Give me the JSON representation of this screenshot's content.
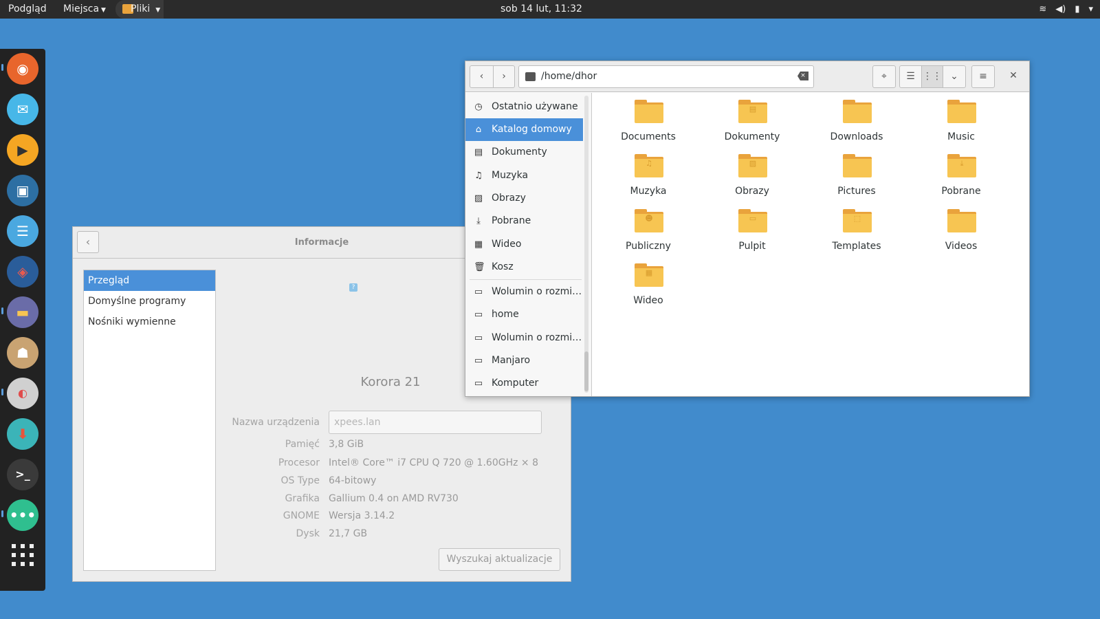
{
  "topbar": {
    "activities": "Podgląd",
    "places_menu": "Miejsca",
    "app_menu": "Pliki",
    "clock": "sob 14 lut, 11:32",
    "icons": [
      "wifi-icon",
      "volume-icon",
      "battery-icon",
      "power-menu-icon"
    ]
  },
  "dock": {
    "items": [
      {
        "name": "firefox",
        "color": "#e8652c"
      },
      {
        "name": "mail",
        "color": "#47b7e8"
      },
      {
        "name": "media-player",
        "color": "#f5a623"
      },
      {
        "name": "image-viewer",
        "color": "#2d6fa3"
      },
      {
        "name": "text-editor",
        "color": "#4aa8e0"
      },
      {
        "name": "software-center",
        "color": "#2a5d9a"
      },
      {
        "name": "files",
        "color": "#6a6ca8"
      },
      {
        "name": "store",
        "color": "#c9a372"
      },
      {
        "name": "settings-toggles",
        "color": "#d0d0d0"
      },
      {
        "name": "updater",
        "color": "#3bb4b8"
      },
      {
        "name": "terminal",
        "color": "#3a3a3a"
      },
      {
        "name": "chat",
        "color": "#2fbf8f"
      }
    ]
  },
  "settings": {
    "title": "Informacje",
    "sidebar": [
      "Przegląd",
      "Domyślne programy",
      "Nośniki wymienne"
    ],
    "os_name": "Korora 21",
    "device_name_label": "Nazwa urządzenia",
    "device_name_value": "xpees.lan",
    "rows": [
      {
        "label": "Pamięć",
        "value": "3,8 GiB"
      },
      {
        "label": "Procesor",
        "value": "Intel® Core™ i7 CPU Q 720 @ 1.60GHz × 8"
      },
      {
        "label": "OS Type",
        "value": "64-bitowy"
      },
      {
        "label": "Grafika",
        "value": "Gallium 0.4 on AMD RV730"
      },
      {
        "label": "GNOME",
        "value": "Wersja 3.14.2"
      },
      {
        "label": "Dysk",
        "value": "21,7 GB"
      }
    ],
    "update_button": "Wyszukaj aktualizacje"
  },
  "files": {
    "path": "/home/dhor",
    "places": [
      {
        "label": "Ostatnio używane",
        "icon": "recent-icon"
      },
      {
        "label": "Katalog domowy",
        "icon": "home-icon"
      },
      {
        "label": "Dokumenty",
        "icon": "document-icon"
      },
      {
        "label": "Muzyka",
        "icon": "music-icon"
      },
      {
        "label": "Obrazy",
        "icon": "pictures-icon"
      },
      {
        "label": "Pobrane",
        "icon": "download-icon"
      },
      {
        "label": "Wideo",
        "icon": "video-icon"
      },
      {
        "label": "Kosz",
        "icon": "trash-icon"
      },
      {
        "label": "Wolumin o rozmia…",
        "icon": "drive-icon"
      },
      {
        "label": "home",
        "icon": "drive-icon"
      },
      {
        "label": "Wolumin o rozmia…",
        "icon": "drive-icon"
      },
      {
        "label": "Manjaro",
        "icon": "drive-icon"
      },
      {
        "label": "Komputer",
        "icon": "computer-icon"
      }
    ],
    "items": [
      {
        "label": "Documents",
        "emblem": ""
      },
      {
        "label": "Dokumenty",
        "emblem": "document"
      },
      {
        "label": "Downloads",
        "emblem": ""
      },
      {
        "label": "Music",
        "emblem": ""
      },
      {
        "label": "Muzyka",
        "emblem": "music"
      },
      {
        "label": "Obrazy",
        "emblem": "pictures"
      },
      {
        "label": "Pictures",
        "emblem": ""
      },
      {
        "label": "Pobrane",
        "emblem": "download"
      },
      {
        "label": "Publiczny",
        "emblem": "public"
      },
      {
        "label": "Pulpit",
        "emblem": "desktop"
      },
      {
        "label": "Templates",
        "emblem": "templates"
      },
      {
        "label": "Videos",
        "emblem": ""
      },
      {
        "label": "Wideo",
        "emblem": "video"
      }
    ]
  }
}
